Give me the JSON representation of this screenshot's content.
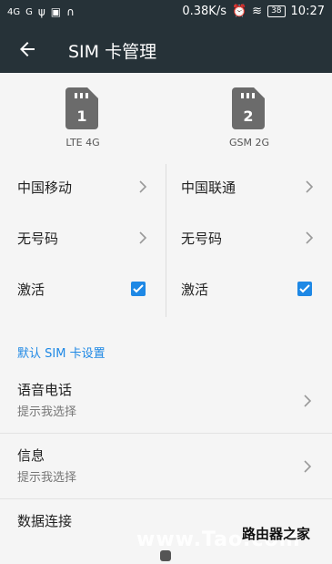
{
  "status": {
    "signal1": "4G",
    "signal2": "G",
    "speed": "0.38K/s",
    "battery": "38",
    "time": "10:27"
  },
  "appbar": {
    "title": "SIM 卡管理"
  },
  "sim1": {
    "number": "1",
    "type": "LTE 4G",
    "carrier": "中国移动",
    "phone": "无号码",
    "active_label": "激活",
    "active": true
  },
  "sim2": {
    "number": "2",
    "type": "GSM 2G",
    "carrier": "中国联通",
    "phone": "无号码",
    "active_label": "激活",
    "active": true
  },
  "default_section": {
    "title": "默认 SIM 卡设置"
  },
  "settings": [
    {
      "title": "语音电话",
      "subtitle": "提示我选择"
    },
    {
      "title": "信息",
      "subtitle": "提示我选择"
    },
    {
      "title": "数据连接",
      "subtitle": ""
    }
  ],
  "watermark": {
    "text": "www.Tao.com",
    "brand": "路由器之家"
  },
  "colors": {
    "appbar": "#263238",
    "accent": "#1e88e5",
    "background": "#f5f5f5"
  }
}
